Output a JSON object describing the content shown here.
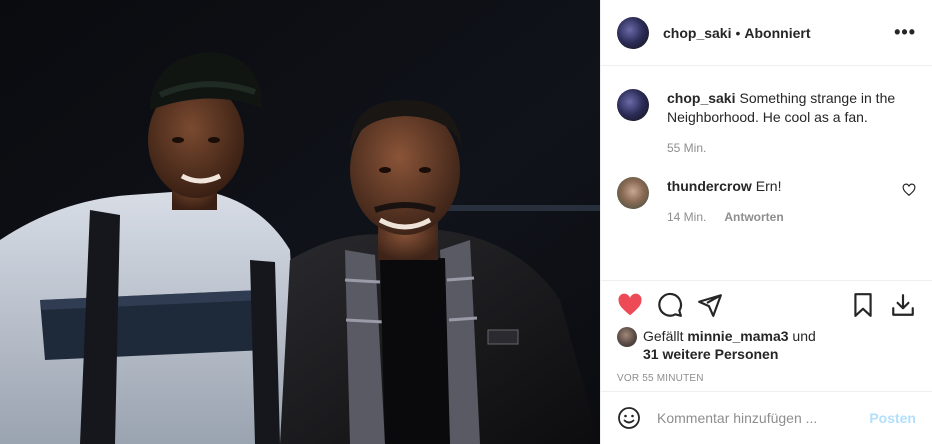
{
  "post": {
    "username": "chop_saki",
    "follow_status": "Abonniert",
    "more_label": "•••"
  },
  "caption": {
    "username": "chop_saki",
    "text": "Something strange in the Neighborhood. He cool as a fan.",
    "time": "55 Min."
  },
  "comments": [
    {
      "username": "thundercrow",
      "text": "Ern!",
      "time": "14 Min.",
      "reply_label": "Antworten"
    }
  ],
  "likes": {
    "prefix": "Gefällt",
    "user": "minnie_mama3",
    "and": "und",
    "others": "31 weitere Personen"
  },
  "timestamp": "VOR 55 MINUTEN",
  "add_comment": {
    "placeholder": "Kommentar hinzufügen ...",
    "post_label": "Posten"
  },
  "icons": {
    "like": "heart-filled-icon",
    "comment": "comment-bubble-icon",
    "share": "paper-plane-icon",
    "save": "bookmark-icon",
    "download": "download-icon",
    "emoji": "smiley-icon",
    "comment_like": "heart-outline-icon"
  },
  "colors": {
    "like_red": "#ed4956",
    "post_button_disabled": "#b2dffc",
    "muted_text": "#8e8e8e"
  }
}
